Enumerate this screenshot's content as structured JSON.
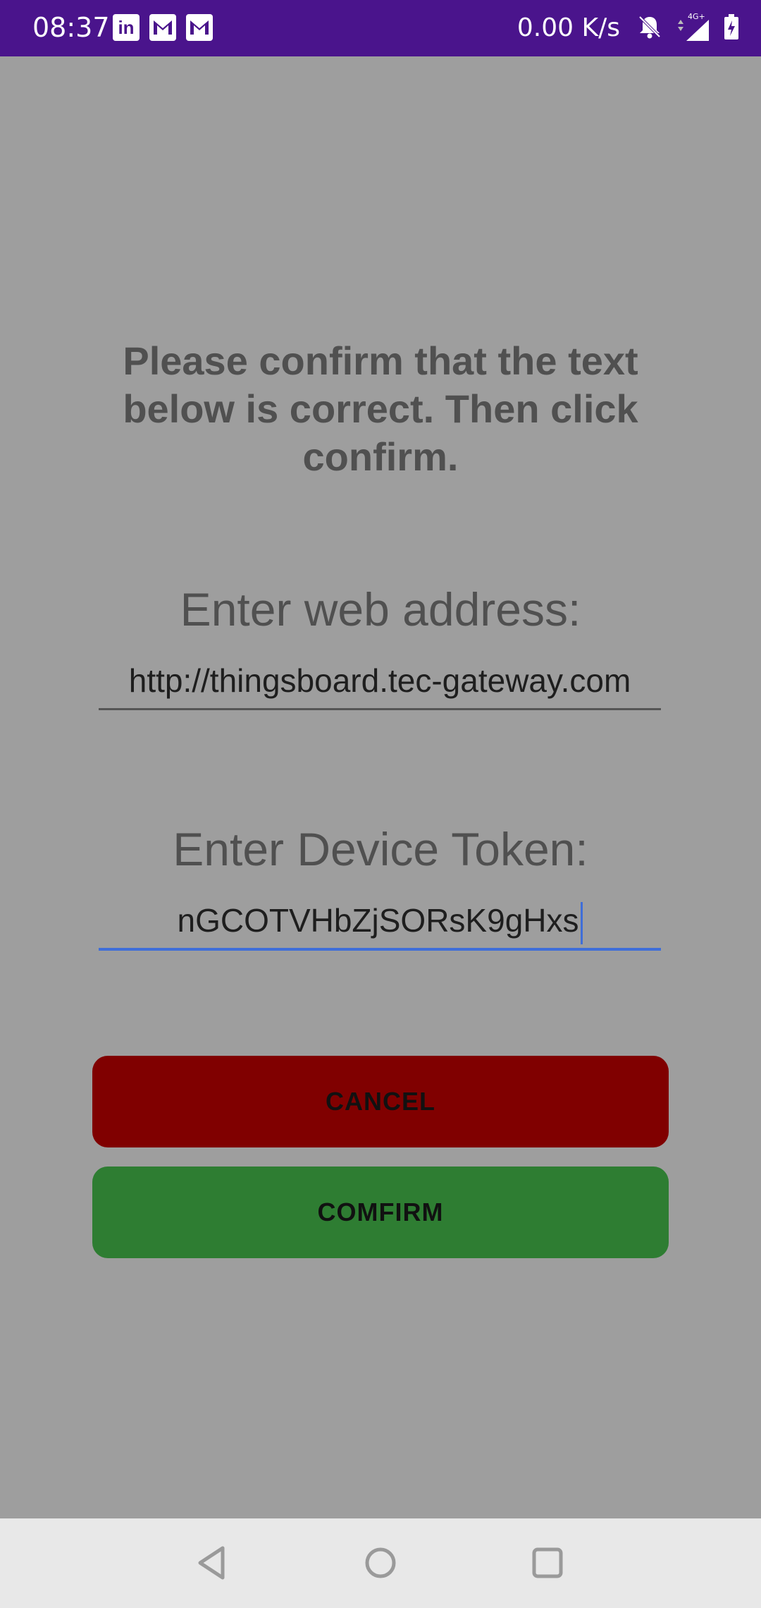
{
  "status_bar": {
    "time": "08:37",
    "net_speed": "0.00 K/s",
    "network_type": "4G+",
    "left_icons": [
      "linkedin-icon",
      "gmail-icon",
      "gmail-icon"
    ],
    "right_icons": [
      "bell-off-icon",
      "signal-icon",
      "battery-charging-icon"
    ],
    "background_color": "#4a148c"
  },
  "form": {
    "prompt": "Please confirm that the text below is correct. Then click confirm.",
    "web_address_label": "Enter web address:",
    "web_address_value": "http://thingsboard.tec-gateway.com",
    "device_token_label": "Enter Device Token:",
    "device_token_value": "nGCOTVHbZjSORsK9gHxs"
  },
  "buttons": {
    "cancel_label": "CANCEL",
    "confirm_label": "COMFIRM",
    "cancel_color": "#800000",
    "confirm_color": "#2e7d32"
  },
  "nav_bar": {
    "items": [
      "back-icon",
      "home-icon",
      "recents-icon"
    ]
  }
}
